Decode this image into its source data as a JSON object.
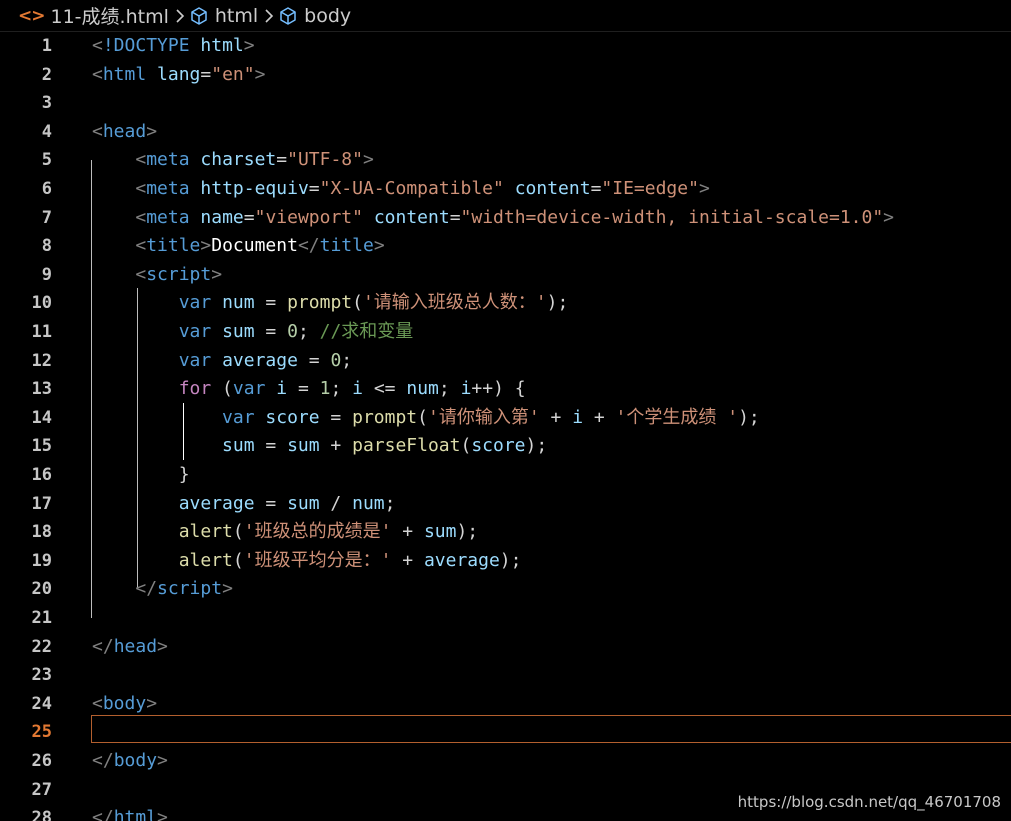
{
  "breadcrumb": {
    "file_icon": "html-file-icon",
    "file": "11-成绩.html",
    "element1_icon": "cube-icon",
    "element1": "html",
    "element2_icon": "cube-icon",
    "element2": "body"
  },
  "editor": {
    "active_line": 25,
    "colors": {
      "background": "#000000",
      "active_line_number": "#e37933",
      "line_number": "#c6c6c6",
      "tag": "#569cd6",
      "attribute": "#9cdcfe",
      "string": "#ce9178",
      "function": "#dcdcaa",
      "number": "#b5cea8",
      "comment": "#6a9955",
      "control_keyword": "#c586c0",
      "punctuation": "#808080"
    },
    "lines": [
      {
        "n": "1",
        "tokens": [
          {
            "c": "punct",
            "t": "<"
          },
          {
            "c": "tag",
            "t": "!DOCTYPE"
          },
          {
            "c": "op",
            "t": " "
          },
          {
            "c": "attr",
            "t": "html"
          },
          {
            "c": "punct",
            "t": ">"
          }
        ]
      },
      {
        "n": "2",
        "tokens": [
          {
            "c": "punct",
            "t": "<"
          },
          {
            "c": "tag",
            "t": "html"
          },
          {
            "c": "op",
            "t": " "
          },
          {
            "c": "attr",
            "t": "lang"
          },
          {
            "c": "op",
            "t": "="
          },
          {
            "c": "str",
            "t": "\"en\""
          },
          {
            "c": "punct",
            "t": ">"
          }
        ]
      },
      {
        "n": "3",
        "tokens": []
      },
      {
        "n": "4",
        "tokens": [
          {
            "c": "punct",
            "t": "<"
          },
          {
            "c": "tag",
            "t": "head"
          },
          {
            "c": "punct",
            "t": ">"
          }
        ]
      },
      {
        "n": "5",
        "tokens": [
          {
            "c": "op",
            "t": "    "
          },
          {
            "c": "punct",
            "t": "<"
          },
          {
            "c": "tag",
            "t": "meta"
          },
          {
            "c": "op",
            "t": " "
          },
          {
            "c": "attr",
            "t": "charset"
          },
          {
            "c": "op",
            "t": "="
          },
          {
            "c": "str",
            "t": "\"UTF-8\""
          },
          {
            "c": "punct",
            "t": ">"
          }
        ]
      },
      {
        "n": "6",
        "tokens": [
          {
            "c": "op",
            "t": "    "
          },
          {
            "c": "punct",
            "t": "<"
          },
          {
            "c": "tag",
            "t": "meta"
          },
          {
            "c": "op",
            "t": " "
          },
          {
            "c": "attr",
            "t": "http-equiv"
          },
          {
            "c": "op",
            "t": "="
          },
          {
            "c": "str",
            "t": "\"X-UA-Compatible\""
          },
          {
            "c": "op",
            "t": " "
          },
          {
            "c": "attr",
            "t": "content"
          },
          {
            "c": "op",
            "t": "="
          },
          {
            "c": "str",
            "t": "\"IE=edge\""
          },
          {
            "c": "punct",
            "t": ">"
          }
        ]
      },
      {
        "n": "7",
        "tokens": [
          {
            "c": "op",
            "t": "    "
          },
          {
            "c": "punct",
            "t": "<"
          },
          {
            "c": "tag",
            "t": "meta"
          },
          {
            "c": "op",
            "t": " "
          },
          {
            "c": "attr",
            "t": "name"
          },
          {
            "c": "op",
            "t": "="
          },
          {
            "c": "str",
            "t": "\"viewport\""
          },
          {
            "c": "op",
            "t": " "
          },
          {
            "c": "attr",
            "t": "content"
          },
          {
            "c": "op",
            "t": "="
          },
          {
            "c": "str",
            "t": "\"width=device-width, initial-scale=1.0\""
          },
          {
            "c": "punct",
            "t": ">"
          }
        ]
      },
      {
        "n": "8",
        "tokens": [
          {
            "c": "op",
            "t": "    "
          },
          {
            "c": "punct",
            "t": "<"
          },
          {
            "c": "tag",
            "t": "title"
          },
          {
            "c": "punct",
            "t": ">"
          },
          {
            "c": "txt",
            "t": "Document"
          },
          {
            "c": "punct",
            "t": "</"
          },
          {
            "c": "tag",
            "t": "title"
          },
          {
            "c": "punct",
            "t": ">"
          }
        ]
      },
      {
        "n": "9",
        "tokens": [
          {
            "c": "op",
            "t": "    "
          },
          {
            "c": "punct",
            "t": "<"
          },
          {
            "c": "tag",
            "t": "script"
          },
          {
            "c": "punct",
            "t": ">"
          }
        ]
      },
      {
        "n": "10",
        "tokens": [
          {
            "c": "op",
            "t": "        "
          },
          {
            "c": "kw",
            "t": "var"
          },
          {
            "c": "op",
            "t": " "
          },
          {
            "c": "var",
            "t": "num"
          },
          {
            "c": "op",
            "t": " = "
          },
          {
            "c": "fn",
            "t": "prompt"
          },
          {
            "c": "op",
            "t": "("
          },
          {
            "c": "str",
            "t": "'请输入班级总人数：'"
          },
          {
            "c": "op",
            "t": ");"
          }
        ]
      },
      {
        "n": "11",
        "tokens": [
          {
            "c": "op",
            "t": "        "
          },
          {
            "c": "kw",
            "t": "var"
          },
          {
            "c": "op",
            "t": " "
          },
          {
            "c": "var",
            "t": "sum"
          },
          {
            "c": "op",
            "t": " = "
          },
          {
            "c": "num",
            "t": "0"
          },
          {
            "c": "op",
            "t": "; "
          },
          {
            "c": "cmt",
            "t": "//求和变量"
          }
        ]
      },
      {
        "n": "12",
        "tokens": [
          {
            "c": "op",
            "t": "        "
          },
          {
            "c": "kw",
            "t": "var"
          },
          {
            "c": "op",
            "t": " "
          },
          {
            "c": "var",
            "t": "average"
          },
          {
            "c": "op",
            "t": " = "
          },
          {
            "c": "num",
            "t": "0"
          },
          {
            "c": "op",
            "t": ";"
          }
        ]
      },
      {
        "n": "13",
        "tokens": [
          {
            "c": "op",
            "t": "        "
          },
          {
            "c": "kw2",
            "t": "for"
          },
          {
            "c": "op",
            "t": " ("
          },
          {
            "c": "kw",
            "t": "var"
          },
          {
            "c": "op",
            "t": " "
          },
          {
            "c": "var",
            "t": "i"
          },
          {
            "c": "op",
            "t": " = "
          },
          {
            "c": "num",
            "t": "1"
          },
          {
            "c": "op",
            "t": "; "
          },
          {
            "c": "var",
            "t": "i"
          },
          {
            "c": "op",
            "t": " <= "
          },
          {
            "c": "var",
            "t": "num"
          },
          {
            "c": "op",
            "t": "; "
          },
          {
            "c": "var",
            "t": "i"
          },
          {
            "c": "op",
            "t": "++) {"
          }
        ]
      },
      {
        "n": "14",
        "tokens": [
          {
            "c": "op",
            "t": "            "
          },
          {
            "c": "kw",
            "t": "var"
          },
          {
            "c": "op",
            "t": " "
          },
          {
            "c": "var",
            "t": "score"
          },
          {
            "c": "op",
            "t": " = "
          },
          {
            "c": "fn",
            "t": "prompt"
          },
          {
            "c": "op",
            "t": "("
          },
          {
            "c": "str",
            "t": "'请你输入第'"
          },
          {
            "c": "op",
            "t": " + "
          },
          {
            "c": "var",
            "t": "i"
          },
          {
            "c": "op",
            "t": " + "
          },
          {
            "c": "str",
            "t": "'个学生成绩 '"
          },
          {
            "c": "op",
            "t": ");"
          }
        ]
      },
      {
        "n": "15",
        "tokens": [
          {
            "c": "op",
            "t": "            "
          },
          {
            "c": "var",
            "t": "sum"
          },
          {
            "c": "op",
            "t": " = "
          },
          {
            "c": "var",
            "t": "sum"
          },
          {
            "c": "op",
            "t": " + "
          },
          {
            "c": "fn",
            "t": "parseFloat"
          },
          {
            "c": "op",
            "t": "("
          },
          {
            "c": "var",
            "t": "score"
          },
          {
            "c": "op",
            "t": ");"
          }
        ]
      },
      {
        "n": "16",
        "tokens": [
          {
            "c": "op",
            "t": "        }"
          }
        ]
      },
      {
        "n": "17",
        "tokens": [
          {
            "c": "op",
            "t": "        "
          },
          {
            "c": "var",
            "t": "average"
          },
          {
            "c": "op",
            "t": " = "
          },
          {
            "c": "var",
            "t": "sum"
          },
          {
            "c": "op",
            "t": " / "
          },
          {
            "c": "var",
            "t": "num"
          },
          {
            "c": "op",
            "t": ";"
          }
        ]
      },
      {
        "n": "18",
        "tokens": [
          {
            "c": "op",
            "t": "        "
          },
          {
            "c": "fn",
            "t": "alert"
          },
          {
            "c": "op",
            "t": "("
          },
          {
            "c": "str",
            "t": "'班级总的成绩是'"
          },
          {
            "c": "op",
            "t": " + "
          },
          {
            "c": "var",
            "t": "sum"
          },
          {
            "c": "op",
            "t": ");"
          }
        ]
      },
      {
        "n": "19",
        "tokens": [
          {
            "c": "op",
            "t": "        "
          },
          {
            "c": "fn",
            "t": "alert"
          },
          {
            "c": "op",
            "t": "("
          },
          {
            "c": "str",
            "t": "'班级平均分是：'"
          },
          {
            "c": "op",
            "t": " + "
          },
          {
            "c": "var",
            "t": "average"
          },
          {
            "c": "op",
            "t": ");"
          }
        ]
      },
      {
        "n": "20",
        "tokens": [
          {
            "c": "op",
            "t": "    "
          },
          {
            "c": "punct",
            "t": "</"
          },
          {
            "c": "tag",
            "t": "script"
          },
          {
            "c": "punct",
            "t": ">"
          }
        ]
      },
      {
        "n": "21",
        "tokens": []
      },
      {
        "n": "22",
        "tokens": [
          {
            "c": "punct",
            "t": "</"
          },
          {
            "c": "tag",
            "t": "head"
          },
          {
            "c": "punct",
            "t": ">"
          }
        ]
      },
      {
        "n": "23",
        "tokens": []
      },
      {
        "n": "24",
        "tokens": [
          {
            "c": "punct",
            "t": "<"
          },
          {
            "c": "tag",
            "t": "body"
          },
          {
            "c": "punct",
            "t": ">"
          }
        ]
      },
      {
        "n": "25",
        "tokens": []
      },
      {
        "n": "26",
        "tokens": [
          {
            "c": "punct",
            "t": "</"
          },
          {
            "c": "tag",
            "t": "body"
          },
          {
            "c": "punct",
            "t": ">"
          }
        ]
      },
      {
        "n": "27",
        "tokens": []
      },
      {
        "n": "28",
        "tokens": [
          {
            "c": "punct",
            "t": "</"
          },
          {
            "c": "tag",
            "t": "html"
          },
          {
            "c": "punct",
            "t": ">"
          }
        ]
      }
    ]
  },
  "watermark": "https://blog.csdn.net/qq_46701708"
}
